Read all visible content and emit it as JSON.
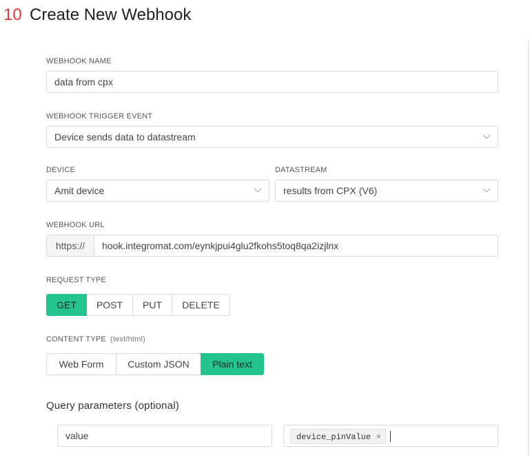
{
  "header": {
    "step": "10",
    "title": "Create New Webhook"
  },
  "webhook_name": {
    "label": "WEBHOOK NAME",
    "value": "data from cpx"
  },
  "trigger_event": {
    "label": "WEBHOOK TRIGGER EVENT",
    "value": "Device sends data to datastream"
  },
  "device": {
    "label": "DEVICE",
    "value": "Amit device"
  },
  "datastream": {
    "label": "DATASTREAM",
    "value": "results from CPX (V6)"
  },
  "webhook_url": {
    "label": "WEBHOOK URL",
    "prefix": "https://",
    "value": "hook.integromat.com/eynkjpui4glu2fkohs5toq8qa2izjlnx"
  },
  "request_type": {
    "label": "REQUEST TYPE",
    "options": [
      "GET",
      "POST",
      "PUT",
      "DELETE"
    ],
    "selected": "GET"
  },
  "content_type": {
    "label": "CONTENT TYPE",
    "hint": "(text/html)",
    "options": [
      "Web Form",
      "Custom JSON",
      "Plain text"
    ],
    "selected": "Plain text"
  },
  "query_params": {
    "title": "Query parameters (optional)",
    "key": "value",
    "tag": "device_pinValue",
    "tag_remove": "×"
  },
  "colors": {
    "accent": "#23c48e",
    "step_number": "#e53935"
  }
}
